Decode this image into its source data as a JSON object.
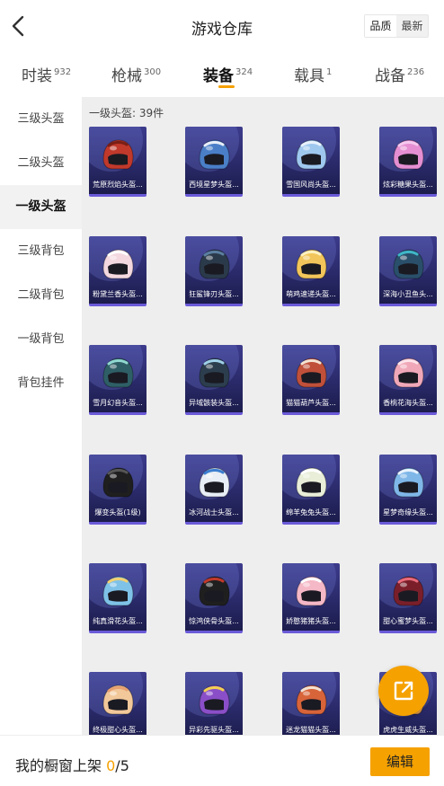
{
  "header": {
    "title": "游戏仓库",
    "sort_options": [
      "品质",
      "最新"
    ],
    "active_sort": 0
  },
  "tabs": [
    {
      "label": "时装",
      "count": "932"
    },
    {
      "label": "枪械",
      "count": "300"
    },
    {
      "label": "装备",
      "count": "324"
    },
    {
      "label": "载具",
      "count": "1"
    },
    {
      "label": "战备",
      "count": "236"
    }
  ],
  "active_tab": 2,
  "sidebar": {
    "items": [
      "三级头盔",
      "二级头盔",
      "一级头盔",
      "三级背包",
      "二级背包",
      "一级背包",
      "背包挂件"
    ],
    "active": 2
  },
  "section": {
    "title": "一级头盔: 39件"
  },
  "items": [
    {
      "label": "荒原烈焰头盔...",
      "color": "#c0392b",
      "accent": "#7a1f16"
    },
    {
      "label": "西境星梦头盔...",
      "color": "#4a7fc8",
      "accent": "#e8eef8"
    },
    {
      "label": "雪国风尚头盔...",
      "color": "#9fc8ef",
      "accent": "#e8f2fc"
    },
    {
      "label": "炫彩糖果头盔...",
      "color": "#e58fd2",
      "accent": "#f5c8ef"
    },
    {
      "label": "粉黛兰香头盔...",
      "color": "#f3d8df",
      "accent": "#ffffff"
    },
    {
      "label": "狂鲨锋刃头盔...",
      "color": "#2b3a4a",
      "accent": "#5b7fa0"
    },
    {
      "label": "萌鸡速递头盔...",
      "color": "#f2c65a",
      "accent": "#fff0bf"
    },
    {
      "label": "深海小丑鱼头...",
      "color": "#2a4f6a",
      "accent": "#3fb7c8"
    },
    {
      "label": "雪月幻音头盔...",
      "color": "#2f5f66",
      "accent": "#8fd8d0"
    },
    {
      "label": "异域骸装头盔...",
      "color": "#2c3e4e",
      "accent": "#9fd0e8"
    },
    {
      "label": "猫猫葫芦头盔...",
      "color": "#c0503a",
      "accent": "#f3e2d2"
    },
    {
      "label": "香桃花海头盔...",
      "color": "#f0a8b8",
      "accent": "#fde3ea"
    },
    {
      "label": "爆变头盔(1级)",
      "color": "#1f1f1f",
      "accent": "#555555"
    },
    {
      "label": "冰河战士头盔...",
      "color": "#e8eef5",
      "accent": "#3b7fd0"
    },
    {
      "label": "绵羊兔兔头盔...",
      "color": "#e8eed8",
      "accent": "#ffffff"
    },
    {
      "label": "星梦奇缘头盔...",
      "color": "#7fb7e8",
      "accent": "#e8f2ff"
    },
    {
      "label": "纯真滑花头盔...",
      "color": "#7fc2e8",
      "accent": "#f2d070"
    },
    {
      "label": "惊鸿侠骨头盔...",
      "color": "#1f1f1f",
      "accent": "#c0392b"
    },
    {
      "label": "娇憨猪猪头盔...",
      "color": "#f5b8c6",
      "accent": "#ffffff"
    },
    {
      "label": "甜心蜜梦头盔...",
      "color": "#7a1f2a",
      "accent": "#e86a7a"
    },
    {
      "label": "终极甜心头盔...",
      "color": "#f2c89a",
      "accent": "#e8a070"
    },
    {
      "label": "异彩先驱头盔...",
      "color": "#8a4fc8",
      "accent": "#f2d050"
    },
    {
      "label": "迷龙猫猫头盔...",
      "color": "#d8643a",
      "accent": "#f2e2d2"
    },
    {
      "label": "虎虎生威头盔...",
      "color": "#e8a04a",
      "accent": "#ffffff"
    }
  ],
  "share": {
    "icon": "share-external-icon"
  },
  "bottom": {
    "label": "我的橱窗上架",
    "used": "0",
    "separator": "/",
    "total": "5",
    "edit_label": "编辑"
  },
  "colors": {
    "accent": "#f5a100"
  }
}
